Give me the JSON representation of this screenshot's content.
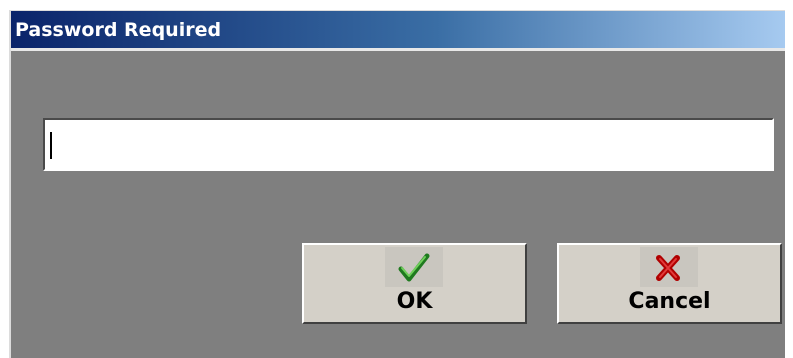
{
  "dialog": {
    "title": "Password Required"
  },
  "password_field": {
    "value": "",
    "placeholder": ""
  },
  "buttons": {
    "ok": {
      "label": "OK",
      "icon": "check-icon",
      "icon_color": "#2e8b2e"
    },
    "cancel": {
      "label": "Cancel",
      "icon": "x-icon",
      "icon_color": "#b00000"
    }
  },
  "colors": {
    "titlebar_start": "#0a246a",
    "titlebar_end": "#a6caf0",
    "dialog_background": "#7f7f7f",
    "button_face": "#d4d0c8"
  }
}
